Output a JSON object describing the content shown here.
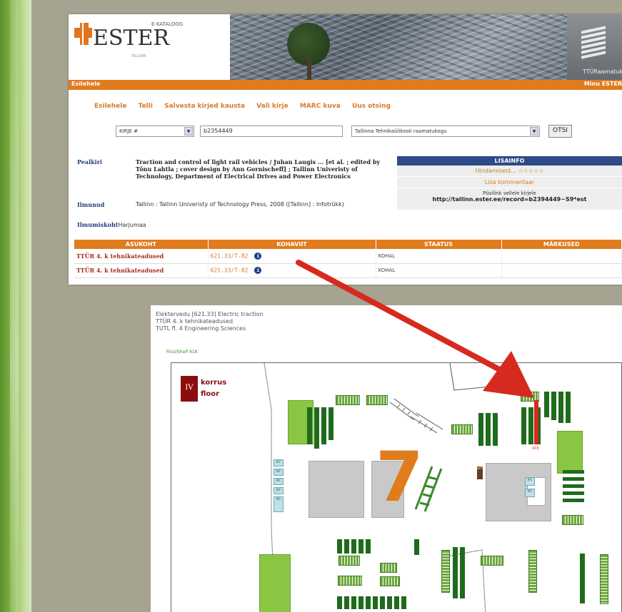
{
  "ester": {
    "logo": {
      "small": "E-KATALOOG",
      "word": "ESTER",
      "city": "TALLINN"
    },
    "ttu_logo": "TTÜRaamatukogu",
    "nav": {
      "left": "Esilehele",
      "right": "Minu ESTER"
    },
    "menu": [
      "Esilehele",
      "Telli",
      "Salvesta kirjed kausta",
      "Vali kirje",
      "MARC kuva",
      "Uus otsing"
    ],
    "search": {
      "type_option": "KIRJE #",
      "query": "b2354449",
      "library_option": "Tallinna Tehnikaülikooli raamatukogu",
      "button": "OTSI"
    },
    "record": {
      "title_label": "Pealkiri",
      "title": "Traction and control of light rail vehicles / Juhan Laugis ... [et al. ; edited by Tõnu Lahtla ; cover design by Ann Gornischeff] ; Tallinn Univeristy of Technology, Department of Electrical Drives and Power Electronics",
      "published_label": "Ilmunud",
      "published": "Tallinn : Tallinn Univeristy of Technology Press, 2008 ([Tallinn] : Infotrükk)",
      "place_label": "Ilmumiskoht",
      "place": "Harjumaa"
    },
    "lisainfo": {
      "header": "LISAINFO",
      "rating": "Hindamisest...",
      "stars": "☆☆☆☆☆",
      "comment": "Lisa kommentaar",
      "permalink_label": "Püsilink sellele kirjele",
      "permalink_url": "http://tallinn.ester.ee/record=b2394449~S9*est"
    },
    "holdings": {
      "headers": [
        "ASUKOHT",
        "KOHAVIIT",
        "STAATUS",
        "MÄRKUSED"
      ],
      "rows": [
        {
          "location": "TTÜR 4. k tehnikateadused",
          "callno": "621.33/T-82",
          "status": "KOHAL",
          "notes": ""
        },
        {
          "location": "TTÜR 4. k tehnikateadused",
          "callno": "621.33/T-82",
          "status": "KOHAL",
          "notes": ""
        }
      ]
    }
  },
  "plan": {
    "title_lines": [
      "Elektervedu [621.33] Electric traction",
      "TTÜR 4. k tehnikateadused",
      "TUTL fl. 4 Engineering Sciences"
    ],
    "shelf_ref": "Riiul/Shelf 418",
    "floor_number": "IV",
    "floor_words": [
      "korrus",
      "floor"
    ],
    "big_number": "7",
    "shelf_marker": "418",
    "lift_label": "LIFT",
    "wc_label": "WC",
    "accent": "#d62a1f"
  }
}
